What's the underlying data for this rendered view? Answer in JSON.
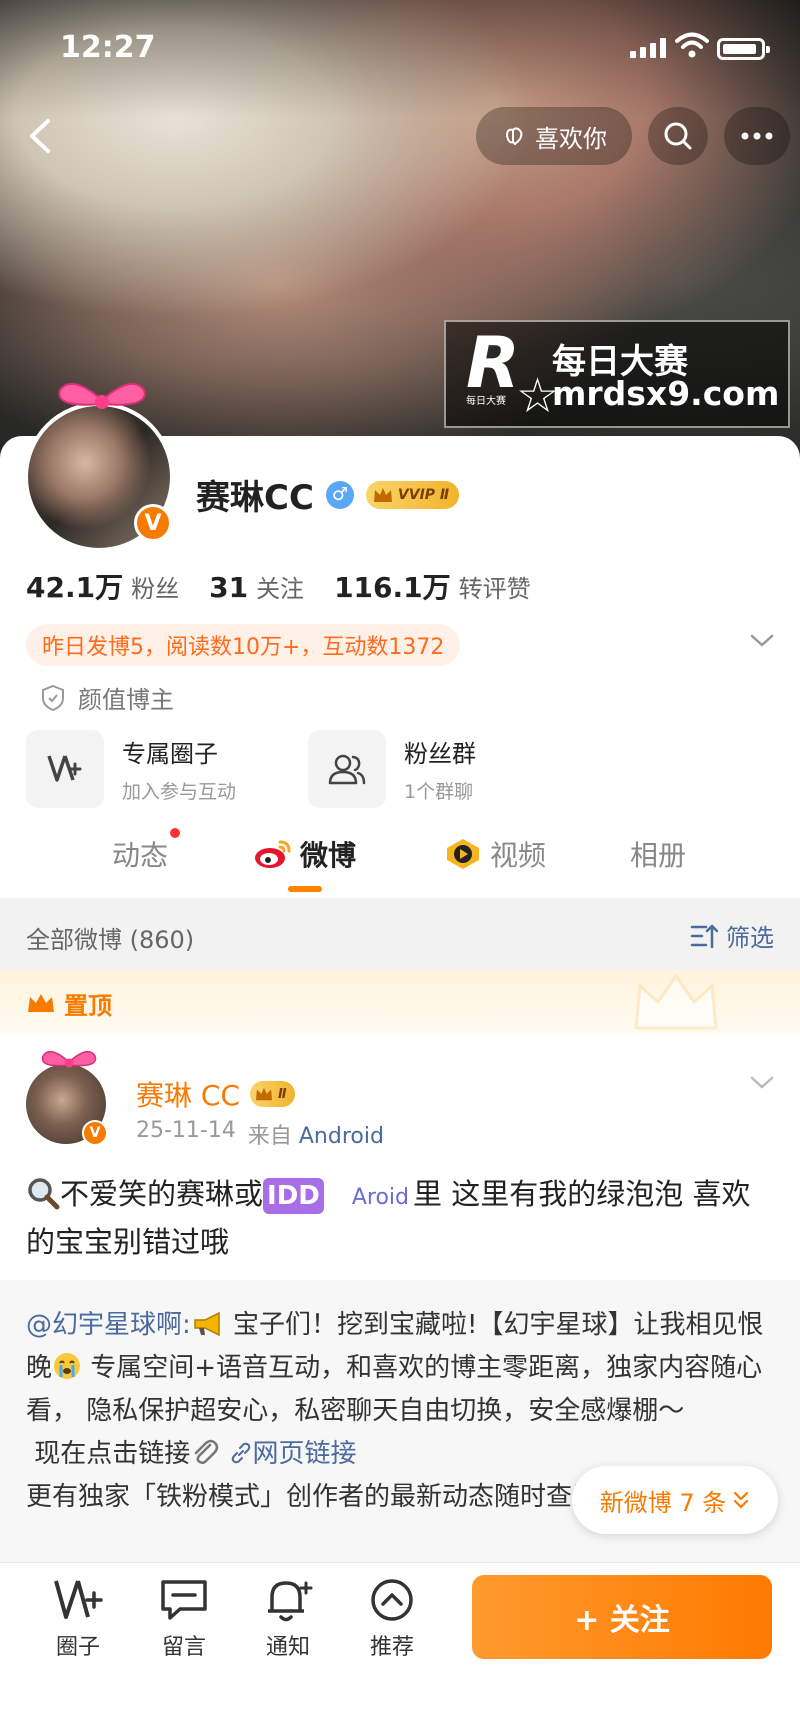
{
  "status_bar": {
    "time": "12:27"
  },
  "header": {
    "like_label": "喜欢你",
    "watermark_cn": "每日大赛",
    "watermark_url": "mrdsx9.com",
    "watermark_logo": "R",
    "watermark_small": "每日大赛"
  },
  "profile": {
    "name": "赛琳CC",
    "gender": "♂",
    "vvip_label": "VVIP Ⅱ",
    "verified_badge": "V",
    "stats": [
      {
        "num": "42.1万",
        "label": "粉丝"
      },
      {
        "num": "31",
        "label": "关注"
      },
      {
        "num": "116.1万",
        "label": "转评赞"
      }
    ],
    "activity": "昨日发博5，阅读数10万+，互动数1372",
    "tag": "颜值博主",
    "features": [
      {
        "title": "专属圈子",
        "sub": "加入参与互动"
      },
      {
        "title": "粉丝群",
        "sub": "1个群聊"
      }
    ]
  },
  "tabs": [
    {
      "label": "动态",
      "active": false
    },
    {
      "label": "微博",
      "active": true
    },
    {
      "label": "视频",
      "active": false
    },
    {
      "label": "相册",
      "active": false
    }
  ],
  "filter": {
    "count_label": "全部微博 (860)",
    "filter_label": "筛选"
  },
  "pinned": {
    "label": "置顶"
  },
  "post": {
    "author": "赛琳 CC",
    "crown_label": "Ⅱ",
    "date": "25-11-14",
    "from": "来自",
    "source": "Android",
    "text_1": "不爱笑的赛琳或",
    "idd": "IDD",
    "aroid": "Aroid",
    "text_2": "里 这里有我的绿泡泡 喜欢的宝宝别错过哦",
    "repost": {
      "mention": "@幻宇星球啊:",
      "body_1": "宝子们！挖到宝藏啦!【幻宇星球】让我相见恨晚",
      "body_2": "专属空间+语音互动，和喜欢的博主零距离，独家内容随心看， 隐私保护超安心，私密聊天自由切换，安全感爆棚～",
      "cta": "现在点击链接",
      "link": "网页链接",
      "more": "更有独家「铁粉模式」创作者的最新动态随时查看"
    }
  },
  "new_posts": "新微博 7 条",
  "bottom": {
    "items": [
      "圈子",
      "留言",
      "通知",
      "推荐"
    ],
    "follow": "+ 关注"
  },
  "colors": {
    "accent": "#ff8200",
    "link": "#4a6b9c",
    "badge": "#f77b00"
  }
}
